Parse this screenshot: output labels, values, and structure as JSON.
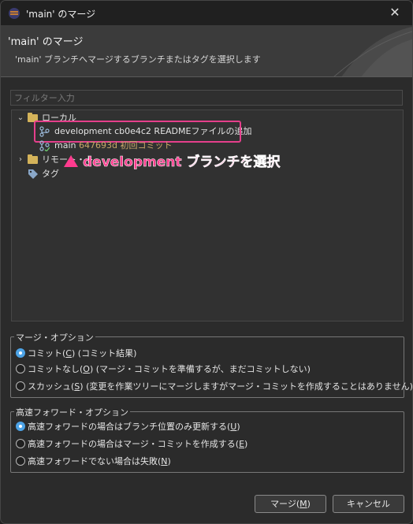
{
  "window": {
    "title": "'main' のマージ"
  },
  "header": {
    "title": "'main' のマージ",
    "description": "'main' ブランチへマージするブランチまたはタグを選択します"
  },
  "filter": {
    "placeholder": "フィルター入力"
  },
  "tree": {
    "local": {
      "label": "ローカル"
    },
    "branches": [
      {
        "name": "development",
        "hash": "cb0e4c2",
        "message": "READMEファイルの追加"
      },
      {
        "name": "main",
        "hash": "647693d",
        "message": "初回コミット"
      }
    ],
    "remote": {
      "label": "リモート・ト"
    },
    "tags": {
      "label": "タグ"
    }
  },
  "annotation": {
    "text": "development ブランチを選択"
  },
  "merge_options": {
    "legend": "マージ・オプション",
    "options": [
      {
        "label": "コミット(",
        "mnemonic": "C",
        "rest": ") (コミット結果)",
        "selected": true
      },
      {
        "label": "コミットなし(",
        "mnemonic": "O",
        "rest": ") (マージ・コミットを準備するが、まだコミットしない)",
        "selected": false
      },
      {
        "label": "スカッシュ(",
        "mnemonic": "S",
        "rest": ") (変更を作業ツリーにマージしますがマージ・コミットを作成することはありません)",
        "selected": false
      }
    ]
  },
  "ff_options": {
    "legend": "高速フォワード・オプション",
    "options": [
      {
        "label": "高速フォワードの場合はブランチ位置のみ更新する(",
        "mnemonic": "U",
        "rest": ")",
        "selected": true
      },
      {
        "label": "高速フォワードの場合はマージ・コミットを作成する(",
        "mnemonic": "E",
        "rest": ")",
        "selected": false
      },
      {
        "label": "高速フォワードでない場合は失敗(",
        "mnemonic": "N",
        "rest": ")",
        "selected": false
      }
    ]
  },
  "buttons": {
    "merge_pre": "マージ(",
    "merge_key": "M",
    "merge_post": ")",
    "cancel": "キャンセル"
  },
  "colors": {
    "accent": "#4da3e6",
    "highlight": "#e53f8b",
    "annotation": "#ff3b8e",
    "hash": "#c9a869"
  }
}
